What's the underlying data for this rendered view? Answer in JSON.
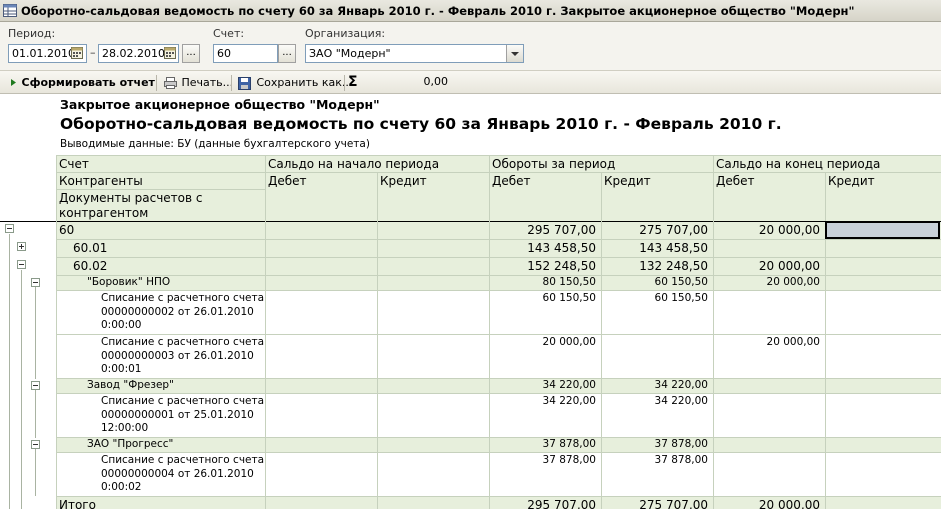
{
  "window": {
    "title": "Оборотно-сальдовая ведомость по счету 60 за Январь 2010 г. - Февраль 2010 г. Закрытое акционерное общество \"Модерн\""
  },
  "params": {
    "period_label": "Период:",
    "date_from": "01.01.2010",
    "date_dash": "–",
    "date_to": "28.02.2010",
    "period_btn": "...",
    "account_label": "Счет:",
    "account_value": "60",
    "account_btn": "...",
    "org_label": "Организация:",
    "org_value": "ЗАО \"Модерн\""
  },
  "toolbar": {
    "generate_label": "Сформировать отчет",
    "print_label": "Печать...",
    "save_label": "Сохранить как...",
    "sum_symbol": "Σ",
    "sum_value": "0,00"
  },
  "report": {
    "org_name": "Закрытое акционерное общество \"Модерн\"",
    "title": "Оборотно-сальдовая ведомость по счету 60 за Январь 2010 г. - Февраль 2010 г.",
    "output_data": "Выводимые данные:  БУ (данные бухгалтерского учета)",
    "headers": {
      "account": "Счет",
      "counterparties": "Контрагенты",
      "documents": "Документы расчетов с контрагентом",
      "opening": "Сальдо на начало периода",
      "turnover": "Обороты за период",
      "closing": "Сальдо на конец периода",
      "debit": "Дебет",
      "credit": "Кредит"
    },
    "rows": [
      {
        "level": 0,
        "name": "60",
        "od": "",
        "oc": "",
        "td": "295 707,00",
        "tc": "275 707,00",
        "cd": "20 000,00",
        "cc": ""
      },
      {
        "level": 1,
        "name": "60.01",
        "od": "",
        "oc": "",
        "td": "143 458,50",
        "tc": "143 458,50",
        "cd": "",
        "cc": ""
      },
      {
        "level": 1,
        "name": "60.02",
        "od": "",
        "oc": "",
        "td": "152 248,50",
        "tc": "132 248,50",
        "cd": "20 000,00",
        "cc": ""
      },
      {
        "level": 2,
        "name": "\"Боровик\" НПО",
        "od": "",
        "oc": "",
        "td": "80 150,50",
        "tc": "60 150,50",
        "cd": "20 000,00",
        "cc": ""
      },
      {
        "level": 3,
        "name": [
          "Списание с расчетного счета",
          "00000000002 от 26.01.2010",
          "0:00:00"
        ],
        "od": "",
        "oc": "",
        "td": "60 150,50",
        "tc": "60 150,50",
        "cd": "",
        "cc": ""
      },
      {
        "level": 3,
        "name": [
          "Списание с расчетного счета",
          "00000000003 от 26.01.2010",
          "0:00:01"
        ],
        "od": "",
        "oc": "",
        "td": "20 000,00",
        "tc": "",
        "cd": "20 000,00",
        "cc": ""
      },
      {
        "level": 2,
        "name": "Завод \"Фрезер\"",
        "od": "",
        "oc": "",
        "td": "34 220,00",
        "tc": "34 220,00",
        "cd": "",
        "cc": ""
      },
      {
        "level": 3,
        "name": [
          "Списание с расчетного счета",
          "00000000001 от 25.01.2010",
          "12:00:00"
        ],
        "od": "",
        "oc": "",
        "td": "34 220,00",
        "tc": "34 220,00",
        "cd": "",
        "cc": ""
      },
      {
        "level": 2,
        "name": "ЗАО \"Прогресс\"",
        "od": "",
        "oc": "",
        "td": "37 878,00",
        "tc": "37 878,00",
        "cd": "",
        "cc": ""
      },
      {
        "level": 3,
        "name": [
          "Списание с расчетного счета",
          "00000000004 от 26.01.2010",
          "0:00:02"
        ],
        "od": "",
        "oc": "",
        "td": "37 878,00",
        "tc": "37 878,00",
        "cd": "",
        "cc": ""
      }
    ],
    "total": {
      "name": "Итого",
      "od": "",
      "oc": "",
      "td": "295 707,00",
      "tc": "275 707,00",
      "cd": "20 000,00",
      "cc": ""
    }
  },
  "colors": {
    "header_bg": "#e7efdc",
    "subtotal_bg": "#e7efdc",
    "grid_line": "#c6d1bd",
    "selection": "#c8d0d8"
  }
}
